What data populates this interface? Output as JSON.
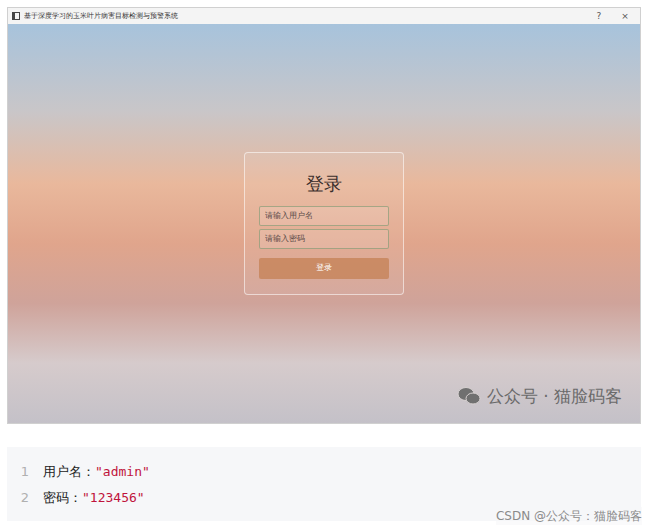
{
  "window": {
    "title": "基于深度学习的玉米叶片病害目标检测与预警系统",
    "buttons": [
      "?",
      "×"
    ]
  },
  "login": {
    "title": "登录",
    "username": {
      "placeholder": "请输入用户名"
    },
    "password": {
      "placeholder": "请输入密码"
    },
    "button": "登录"
  },
  "watermark": "公众号 · 猫脸码客",
  "code": {
    "lines": [
      {
        "number": "1",
        "key": "用户名：",
        "value": "\"admin\""
      },
      {
        "number": "2",
        "key": "密码：",
        "value": "\"123456\""
      }
    ]
  },
  "footer": "CSDN @公众号：猫脸码客"
}
